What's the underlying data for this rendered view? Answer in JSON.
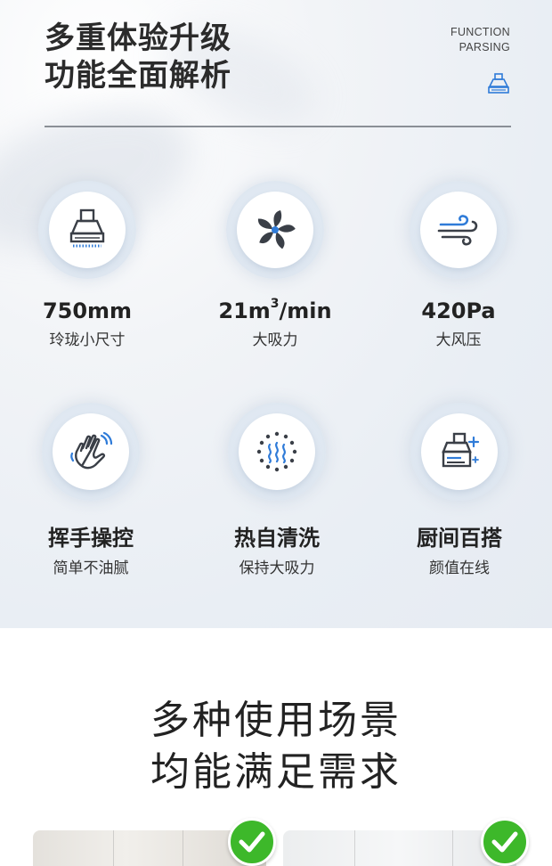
{
  "header": {
    "title_line1": "多重体验升级",
    "title_line2": "功能全面解析",
    "tag_line1": "FUNCTION",
    "tag_line2": "PARSING",
    "tag_icon": "range-hood-icon"
  },
  "features": [
    {
      "icon": "range-hood-icon",
      "title": "750mm",
      "subtitle": "玲珑小尺寸"
    },
    {
      "icon": "fan-icon",
      "title_main": "21m",
      "title_sup": "3",
      "title_tail": "/min",
      "subtitle": "大吸力"
    },
    {
      "icon": "wind-icon",
      "title": "420Pa",
      "subtitle": "大风压"
    },
    {
      "icon": "hand-wave-icon",
      "title": "挥手操控",
      "subtitle": "简单不油腻"
    },
    {
      "icon": "heat-clean-icon",
      "title": "热自清洗",
      "subtitle": "保持大吸力"
    },
    {
      "icon": "kitchen-match-icon",
      "title": "厨间百搭",
      "subtitle": "颜值在线"
    }
  ],
  "scenes": {
    "title_line1": "多种使用场景",
    "title_line2": "均能满足需求",
    "items": [
      {
        "badge": "check-icon"
      },
      {
        "badge": "check-icon"
      }
    ]
  },
  "colors": {
    "accent_blue": "#2f7bd8",
    "icon_dark": "#3a3f47",
    "check_green": "#3db82a"
  }
}
